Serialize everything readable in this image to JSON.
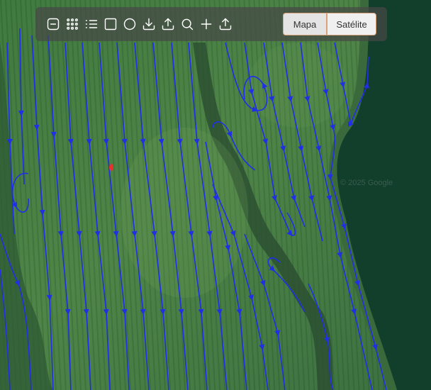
{
  "map": {
    "base_layer": "satellite",
    "colors": {
      "field_dark": "#2d5a34",
      "field_light": "#4d8147",
      "forest": "#123e2c",
      "path": "#1f2fe8",
      "marker": "#e8322c"
    }
  },
  "toolbar": {
    "tools": [
      {
        "icon": "minus-square-icon"
      },
      {
        "icon": "grid-icon"
      },
      {
        "icon": "list-icon"
      },
      {
        "icon": "square-icon"
      },
      {
        "icon": "circle-icon"
      },
      {
        "icon": "download-icon"
      },
      {
        "icon": "upload-icon"
      },
      {
        "icon": "search-icon"
      },
      {
        "icon": "plus-icon"
      },
      {
        "icon": "upload-icon"
      }
    ]
  },
  "layer_switch": {
    "map_label": "Mapa",
    "satellite_label": "Satélite",
    "selected": "Satélite"
  },
  "watermark": "© 2025 Google"
}
